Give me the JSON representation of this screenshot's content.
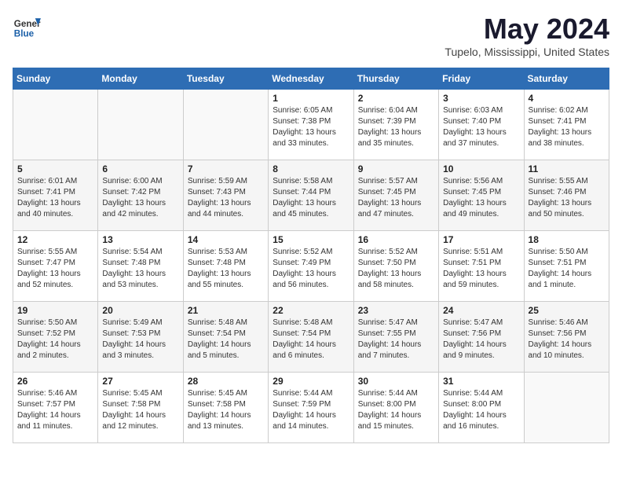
{
  "logo": {
    "general": "General",
    "blue": "Blue"
  },
  "title": "May 2024",
  "location": "Tupelo, Mississippi, United States",
  "days_of_week": [
    "Sunday",
    "Monday",
    "Tuesday",
    "Wednesday",
    "Thursday",
    "Friday",
    "Saturday"
  ],
  "weeks": [
    [
      {
        "day": "",
        "sunrise": "",
        "sunset": "",
        "daylight": ""
      },
      {
        "day": "",
        "sunrise": "",
        "sunset": "",
        "daylight": ""
      },
      {
        "day": "",
        "sunrise": "",
        "sunset": "",
        "daylight": ""
      },
      {
        "day": "1",
        "sunrise": "Sunrise: 6:05 AM",
        "sunset": "Sunset: 7:38 PM",
        "daylight": "Daylight: 13 hours and 33 minutes."
      },
      {
        "day": "2",
        "sunrise": "Sunrise: 6:04 AM",
        "sunset": "Sunset: 7:39 PM",
        "daylight": "Daylight: 13 hours and 35 minutes."
      },
      {
        "day": "3",
        "sunrise": "Sunrise: 6:03 AM",
        "sunset": "Sunset: 7:40 PM",
        "daylight": "Daylight: 13 hours and 37 minutes."
      },
      {
        "day": "4",
        "sunrise": "Sunrise: 6:02 AM",
        "sunset": "Sunset: 7:41 PM",
        "daylight": "Daylight: 13 hours and 38 minutes."
      }
    ],
    [
      {
        "day": "5",
        "sunrise": "Sunrise: 6:01 AM",
        "sunset": "Sunset: 7:41 PM",
        "daylight": "Daylight: 13 hours and 40 minutes."
      },
      {
        "day": "6",
        "sunrise": "Sunrise: 6:00 AM",
        "sunset": "Sunset: 7:42 PM",
        "daylight": "Daylight: 13 hours and 42 minutes."
      },
      {
        "day": "7",
        "sunrise": "Sunrise: 5:59 AM",
        "sunset": "Sunset: 7:43 PM",
        "daylight": "Daylight: 13 hours and 44 minutes."
      },
      {
        "day": "8",
        "sunrise": "Sunrise: 5:58 AM",
        "sunset": "Sunset: 7:44 PM",
        "daylight": "Daylight: 13 hours and 45 minutes."
      },
      {
        "day": "9",
        "sunrise": "Sunrise: 5:57 AM",
        "sunset": "Sunset: 7:45 PM",
        "daylight": "Daylight: 13 hours and 47 minutes."
      },
      {
        "day": "10",
        "sunrise": "Sunrise: 5:56 AM",
        "sunset": "Sunset: 7:45 PM",
        "daylight": "Daylight: 13 hours and 49 minutes."
      },
      {
        "day": "11",
        "sunrise": "Sunrise: 5:55 AM",
        "sunset": "Sunset: 7:46 PM",
        "daylight": "Daylight: 13 hours and 50 minutes."
      }
    ],
    [
      {
        "day": "12",
        "sunrise": "Sunrise: 5:55 AM",
        "sunset": "Sunset: 7:47 PM",
        "daylight": "Daylight: 13 hours and 52 minutes."
      },
      {
        "day": "13",
        "sunrise": "Sunrise: 5:54 AM",
        "sunset": "Sunset: 7:48 PM",
        "daylight": "Daylight: 13 hours and 53 minutes."
      },
      {
        "day": "14",
        "sunrise": "Sunrise: 5:53 AM",
        "sunset": "Sunset: 7:48 PM",
        "daylight": "Daylight: 13 hours and 55 minutes."
      },
      {
        "day": "15",
        "sunrise": "Sunrise: 5:52 AM",
        "sunset": "Sunset: 7:49 PM",
        "daylight": "Daylight: 13 hours and 56 minutes."
      },
      {
        "day": "16",
        "sunrise": "Sunrise: 5:52 AM",
        "sunset": "Sunset: 7:50 PM",
        "daylight": "Daylight: 13 hours and 58 minutes."
      },
      {
        "day": "17",
        "sunrise": "Sunrise: 5:51 AM",
        "sunset": "Sunset: 7:51 PM",
        "daylight": "Daylight: 13 hours and 59 minutes."
      },
      {
        "day": "18",
        "sunrise": "Sunrise: 5:50 AM",
        "sunset": "Sunset: 7:51 PM",
        "daylight": "Daylight: 14 hours and 1 minute."
      }
    ],
    [
      {
        "day": "19",
        "sunrise": "Sunrise: 5:50 AM",
        "sunset": "Sunset: 7:52 PM",
        "daylight": "Daylight: 14 hours and 2 minutes."
      },
      {
        "day": "20",
        "sunrise": "Sunrise: 5:49 AM",
        "sunset": "Sunset: 7:53 PM",
        "daylight": "Daylight: 14 hours and 3 minutes."
      },
      {
        "day": "21",
        "sunrise": "Sunrise: 5:48 AM",
        "sunset": "Sunset: 7:54 PM",
        "daylight": "Daylight: 14 hours and 5 minutes."
      },
      {
        "day": "22",
        "sunrise": "Sunrise: 5:48 AM",
        "sunset": "Sunset: 7:54 PM",
        "daylight": "Daylight: 14 hours and 6 minutes."
      },
      {
        "day": "23",
        "sunrise": "Sunrise: 5:47 AM",
        "sunset": "Sunset: 7:55 PM",
        "daylight": "Daylight: 14 hours and 7 minutes."
      },
      {
        "day": "24",
        "sunrise": "Sunrise: 5:47 AM",
        "sunset": "Sunset: 7:56 PM",
        "daylight": "Daylight: 14 hours and 9 minutes."
      },
      {
        "day": "25",
        "sunrise": "Sunrise: 5:46 AM",
        "sunset": "Sunset: 7:56 PM",
        "daylight": "Daylight: 14 hours and 10 minutes."
      }
    ],
    [
      {
        "day": "26",
        "sunrise": "Sunrise: 5:46 AM",
        "sunset": "Sunset: 7:57 PM",
        "daylight": "Daylight: 14 hours and 11 minutes."
      },
      {
        "day": "27",
        "sunrise": "Sunrise: 5:45 AM",
        "sunset": "Sunset: 7:58 PM",
        "daylight": "Daylight: 14 hours and 12 minutes."
      },
      {
        "day": "28",
        "sunrise": "Sunrise: 5:45 AM",
        "sunset": "Sunset: 7:58 PM",
        "daylight": "Daylight: 14 hours and 13 minutes."
      },
      {
        "day": "29",
        "sunrise": "Sunrise: 5:44 AM",
        "sunset": "Sunset: 7:59 PM",
        "daylight": "Daylight: 14 hours and 14 minutes."
      },
      {
        "day": "30",
        "sunrise": "Sunrise: 5:44 AM",
        "sunset": "Sunset: 8:00 PM",
        "daylight": "Daylight: 14 hours and 15 minutes."
      },
      {
        "day": "31",
        "sunrise": "Sunrise: 5:44 AM",
        "sunset": "Sunset: 8:00 PM",
        "daylight": "Daylight: 14 hours and 16 minutes."
      },
      {
        "day": "",
        "sunrise": "",
        "sunset": "",
        "daylight": ""
      }
    ]
  ]
}
